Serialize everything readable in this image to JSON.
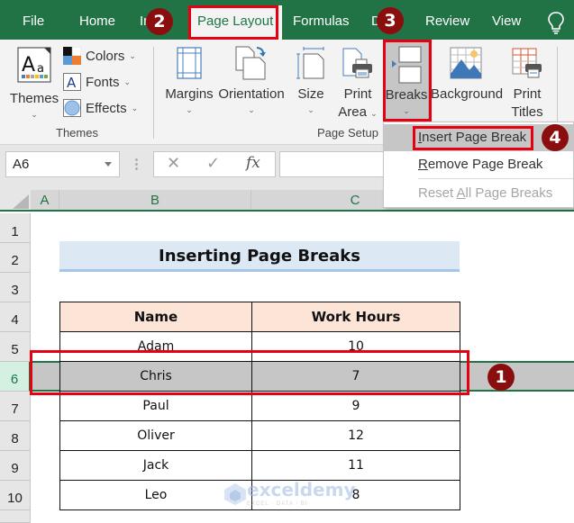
{
  "tabs": [
    {
      "label": "File"
    },
    {
      "label": "Home"
    },
    {
      "label": "In"
    },
    {
      "label": "Page Layout",
      "active": true
    },
    {
      "label": "Formulas"
    },
    {
      "label": "D"
    },
    {
      "label": "Review"
    },
    {
      "label": "View"
    }
  ],
  "ribbon": {
    "themes_group": {
      "label": "Themes",
      "themes_btn": "Themes",
      "colors_btn": "Colors",
      "fonts_btn": "Fonts",
      "effects_btn": "Effects"
    },
    "page_setup_group": {
      "label": "Page Setup",
      "margins": "Margins",
      "orientation": "Orientation",
      "size": "Size",
      "print_area_1": "Print",
      "print_area_2": "Area",
      "breaks": "Breaks",
      "background": "Background",
      "print_titles_1": "Print",
      "print_titles_2": "Titles"
    }
  },
  "breaks_menu": {
    "items": [
      {
        "label": "Insert Page Break",
        "accel": "I",
        "rest": "nsert Page Break",
        "highlighted": true
      },
      {
        "label": "Remove Page Break",
        "accel": "R",
        "rest": "emove Page Break"
      },
      {
        "label": "Reset All Page Breaks",
        "pre": "Reset ",
        "accel": "A",
        "rest": "ll Page Breaks",
        "disabled": true
      }
    ]
  },
  "formula_bar": {
    "name_box": "A6",
    "cancel_icon": "✕",
    "enter_icon": "✓",
    "fx_label": "fx",
    "formula": ""
  },
  "columns": [
    "A",
    "B",
    "C"
  ],
  "rows": [
    "1",
    "2",
    "3",
    "4",
    "5",
    "6",
    "7",
    "8",
    "9",
    "10"
  ],
  "selected_row": "6",
  "sheet": {
    "title": "Inserting Page Breaks",
    "headers": [
      "Name",
      "Work Hours"
    ],
    "data": [
      {
        "name": "Adam",
        "hours": "10"
      },
      {
        "name": "Chris",
        "hours": "7"
      },
      {
        "name": "Paul",
        "hours": "9"
      },
      {
        "name": "Oliver",
        "hours": "12"
      },
      {
        "name": "Jack",
        "hours": "11"
      },
      {
        "name": "Leo",
        "hours": "8"
      }
    ]
  },
  "annotations": {
    "step1": "1",
    "step2": "2",
    "step3": "3",
    "step4": "4",
    "highlight_color": "#e60012",
    "badge_color": "#8b0e0e"
  },
  "watermark": {
    "name": "exceldemy",
    "tagline": "EXCEL · DATA · BI"
  },
  "colors": {
    "excel_green": "#217346",
    "title_fill": "#dce9f5",
    "header_fill": "#fce4d6",
    "selection_fill": "#c6c6c6"
  }
}
